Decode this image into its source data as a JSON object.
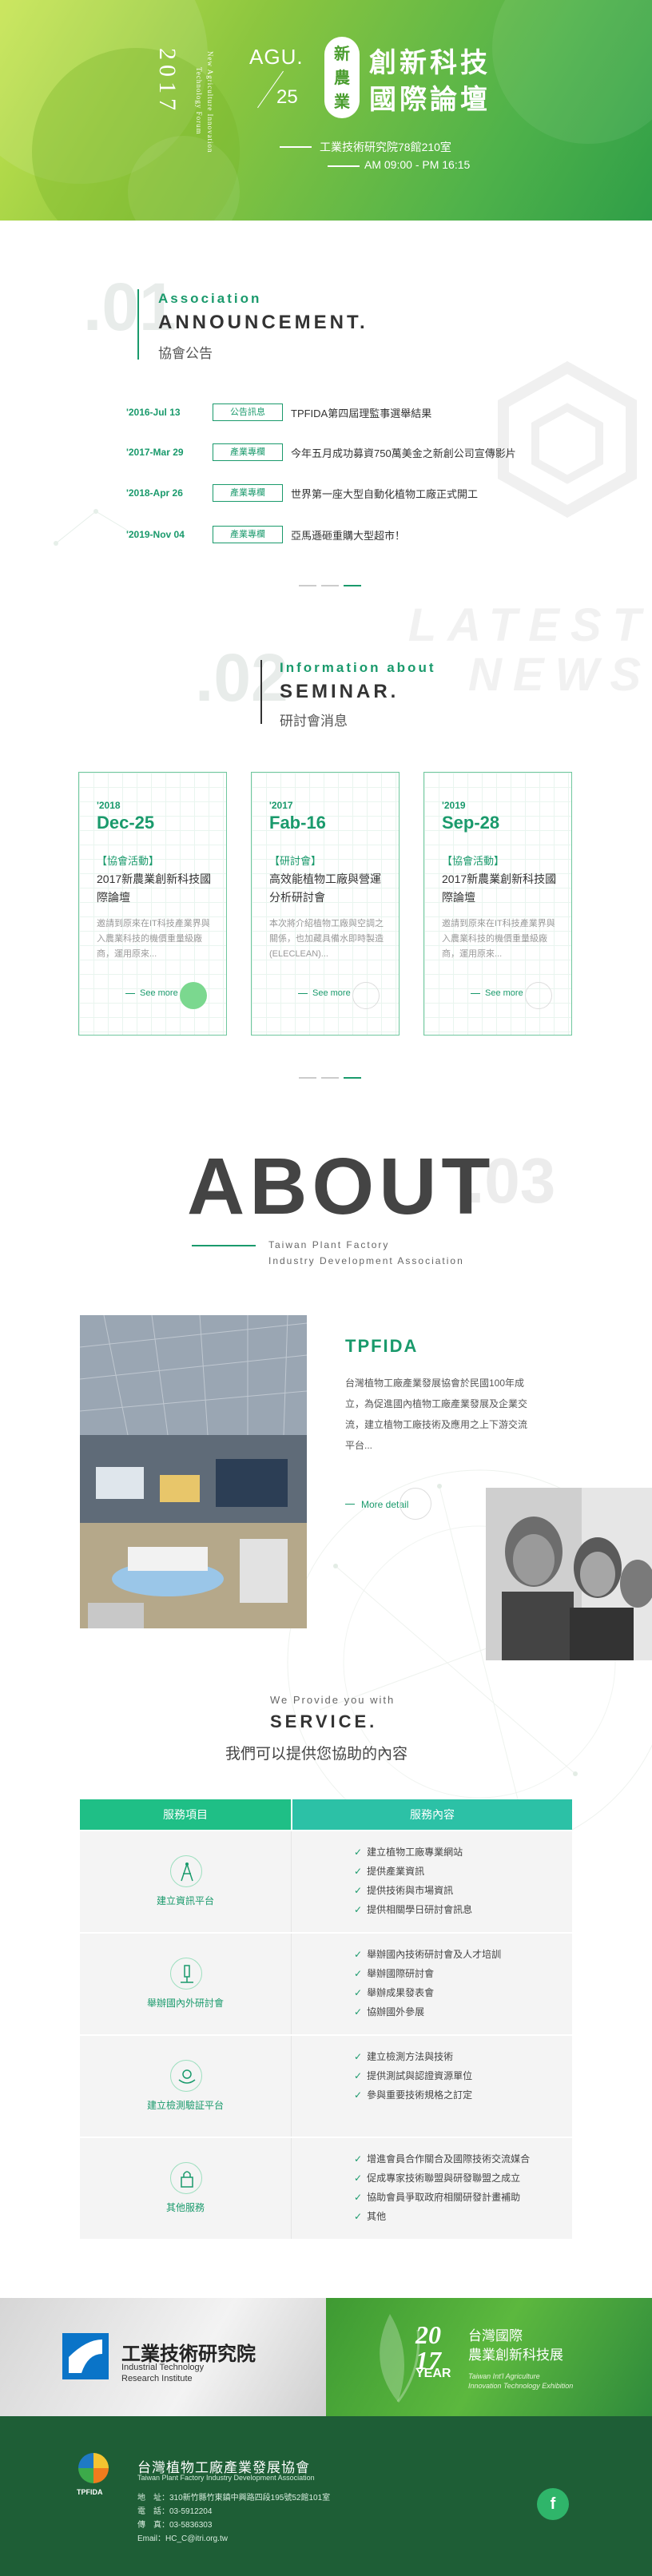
{
  "hero": {
    "year": "2017",
    "sub_line1": "New Agriculture Innovation",
    "sub_line2": "Technology Forum",
    "month": "AGU.",
    "day": "25",
    "badge": "新\n農\n業",
    "title_line1": "創新科技",
    "title_line2": "國際論壇",
    "location": "工業技術研究院78館210室",
    "time": "AM 09:00 - PM 16:15"
  },
  "announcement": {
    "number": ".01",
    "eyebrow": "Association",
    "title": "ANNOUNCEMENT.",
    "subtitle": "協會公告",
    "items": [
      {
        "date": "'2016-Jul 13",
        "tag": "公告訊息",
        "text": "TPFIDA第四屆理監事選舉結果"
      },
      {
        "date": "'2017-Mar 29",
        "tag": "產業專欄",
        "text": "今年五月成功募資750萬美金之新創公司宣傳影片"
      },
      {
        "date": "'2018-Apr 26",
        "tag": "產業專欄",
        "text": "世界第一座大型自動化植物工廠正式開工"
      },
      {
        "date": "'2019-Nov 04",
        "tag": "產業專欄",
        "text": "亞馬遜砸重購大型超市！"
      }
    ]
  },
  "seminar": {
    "number": ".02",
    "watermark_line1": "LATEST",
    "watermark_line2": "NEWS",
    "eyebrow": "Information about",
    "title": "SEMINAR.",
    "subtitle": "研討會消息",
    "cards": [
      {
        "year": "'2018",
        "date": "Dec-25",
        "category": "【協會活動】",
        "title": "2017新農業創新科技國際論壇",
        "desc": "邀請到原來在IT科技產業界與入農業科技的機價重量級廠商，運用原來...",
        "more": "See more"
      },
      {
        "year": "'2017",
        "date": "Fab-16",
        "category": "【研討會】",
        "title": "高效能植物工廠與營運分析研討會",
        "desc": "本次將介紹植物工廠與空調之關係，也加藏具備水即時製造(ELECLEAN)...",
        "more": "See more"
      },
      {
        "year": "'2019",
        "date": "Sep-28",
        "category": "【協會活動】",
        "title": "2017新農業創新科技國際論壇",
        "desc": "邀請到原來在IT科技產業界與入農業科技的機價重量級廠商，運用原來...",
        "more": "See more"
      }
    ]
  },
  "about": {
    "title": "ABOUT",
    "number": ".03",
    "eng_line1": "Taiwan Plant Factory",
    "eng_line2": "Industry Development Association",
    "org_title": "TPFIDA",
    "org_text": "台灣植物工廠產業發展協會於民國100年成立，為促進國內植物工廠產業發展及企業交流，建立植物工廠技術及應用之上下游交流平台...",
    "more": "More detail"
  },
  "service": {
    "eyebrow": "We Provide you with",
    "title": "SERVICE.",
    "subtitle": "我們可以提供您協助的內容",
    "head_left": "服務項目",
    "head_right": "服務內容",
    "rows": [
      {
        "name": "建立資訊平台",
        "icon": "tower-icon",
        "items": [
          "建立植物工廠專業網站",
          "提供產業資訊",
          "提供技術與市場資訊",
          "提供相關學日研討會訊息"
        ]
      },
      {
        "name": "舉辦國內外研討會",
        "icon": "microscope-icon",
        "items": [
          "舉辦國內技術研討會及人才培訓",
          "舉辦國際研討會",
          "舉辦成果發表會",
          "協辦國外參展"
        ]
      },
      {
        "name": "建立檢測驗証平台",
        "icon": "hands-icon",
        "items": [
          "建立檢測方法與技術",
          "提供測試與認證資源單位",
          "參與重要技術規格之訂定"
        ]
      },
      {
        "name": "其他服務",
        "icon": "lock-icon",
        "items": [
          "增進會員合作關合及國際技術交流媒合",
          "促成專家技術聯盟與研發聯盟之成立",
          "協助會員爭取政府相關研發計畫補助",
          "其他"
        ]
      }
    ]
  },
  "partners": {
    "itri_name": "工業技術研究院",
    "itri_en1": "Industrial Technology",
    "itri_en2": "Research Institute",
    "expo_year_top": "20",
    "expo_year_bottom": "17",
    "expo_year_word": "YEAR",
    "expo_name1": "台灣國際",
    "expo_name2": "農業創新科技展",
    "expo_en1": "Taiwan Int'l Agriculture",
    "expo_en2": "Innovation Technology Exhibition"
  },
  "footer": {
    "logo_label": "TPFIDA",
    "name": "台灣植物工廠產業發展協會",
    "name_en": "Taiwan Plant Factory Industry Development Association",
    "address": "地　址：310新竹縣竹東鎮中興路四段195號52館101室",
    "phone": "電　話：03-5912204",
    "fax": "傳　真：03-5836303",
    "email": "Email：HC_C@itri.org.tw",
    "fb": "f"
  },
  "colors": {
    "accent": "#1a9a6c",
    "hero_green": "#8cc63f",
    "footer": "#1e5e36"
  }
}
